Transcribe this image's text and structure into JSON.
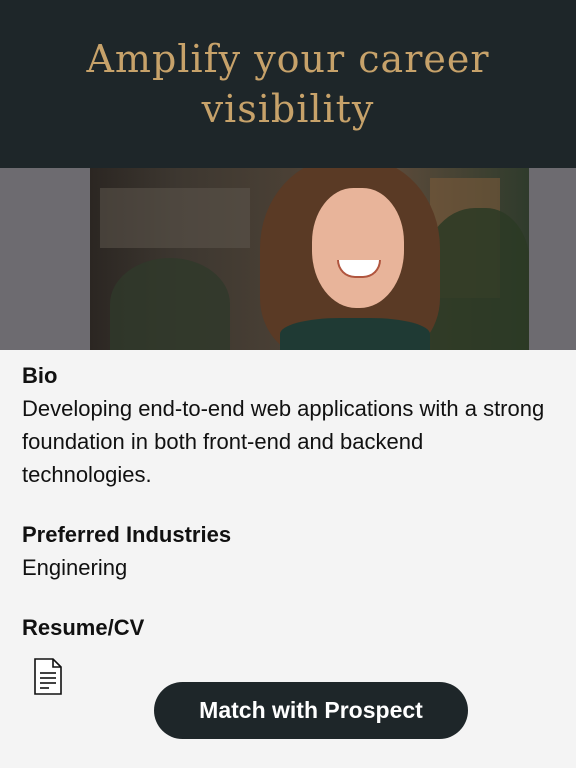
{
  "hero": {
    "title": "Amplify your career visibility"
  },
  "photo": {
    "alt": "profile-photo"
  },
  "bio": {
    "label": "Bio",
    "text": "Developing end-to-end web applications with a strong foundation in both front-end and backend technologies."
  },
  "industries": {
    "label": "Preferred Industries",
    "text": "Enginering"
  },
  "resume": {
    "label": "Resume/CV",
    "icon": "document-icon"
  },
  "actions": {
    "match_label": "Match with Prospect"
  },
  "colors": {
    "dark": "#1e2629",
    "gold": "#c7a26a",
    "background": "#f4f4f4"
  }
}
